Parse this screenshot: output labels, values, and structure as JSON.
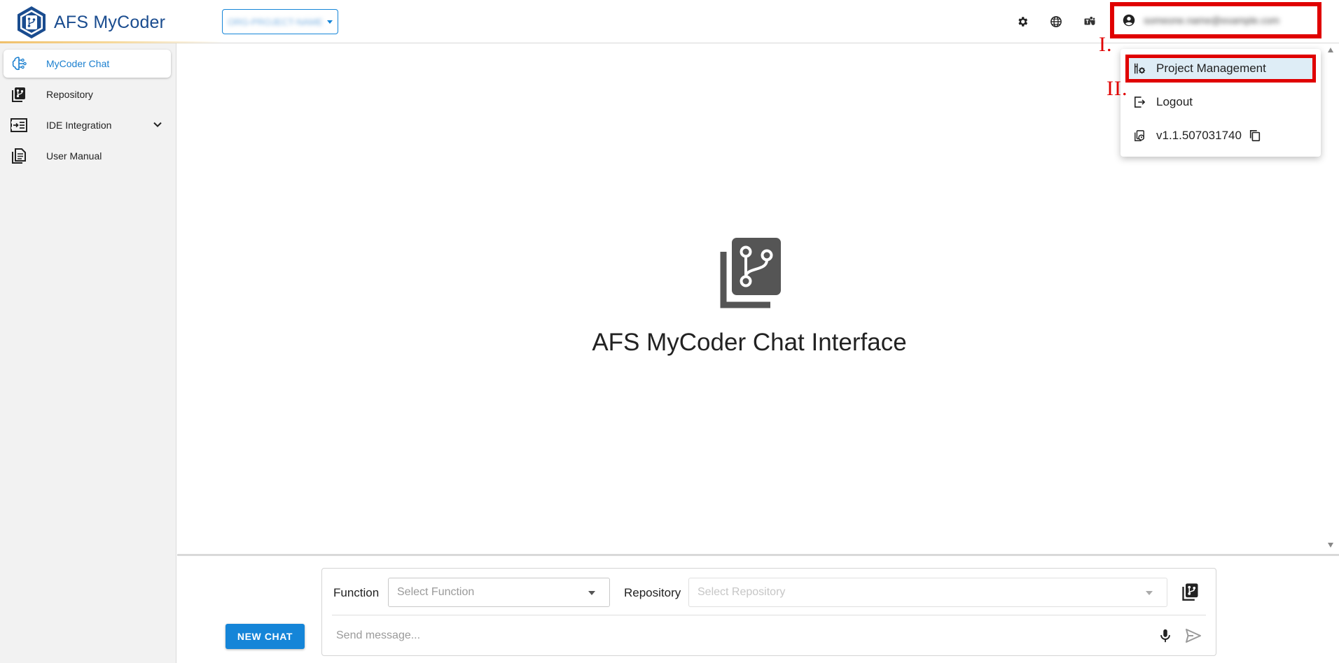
{
  "app": {
    "name": "AFS MyCoder",
    "project_selector": "ORG-PROJECT-NAME",
    "user_email": "someone.name@example.com"
  },
  "header": {
    "icons": [
      "settings-icon",
      "language-globe-icon",
      "teams-icon",
      "account-circle-icon"
    ]
  },
  "sidebar": {
    "items": [
      {
        "label": "MyCoder Chat",
        "icon": "brain-circuit-icon",
        "active": true
      },
      {
        "label": "Repository",
        "icon": "repository-icon"
      },
      {
        "label": "IDE Integration",
        "icon": "ide-integration-icon",
        "expandable": true
      },
      {
        "label": "User Manual",
        "icon": "document-icon"
      }
    ]
  },
  "main": {
    "title": "AFS MyCoder Chat Interface",
    "hero_icon": "repository-icon"
  },
  "chat": {
    "new_chat_label": "NEW CHAT",
    "function_label": "Function",
    "function_placeholder": "Select Function",
    "repository_label": "Repository",
    "repository_placeholder": "Select Repository",
    "message_placeholder": "Send message..."
  },
  "user_menu": {
    "items": [
      {
        "label": "Project Management",
        "icon": "project-tools-icon",
        "highlighted": true
      },
      {
        "label": "Logout",
        "icon": "logout-icon"
      },
      {
        "label": "v1.1.507031740",
        "icon": "version-icon"
      }
    ]
  },
  "annotations": {
    "step1": "I.",
    "step2": "II."
  },
  "colors": {
    "brand_blue": "#1585d8",
    "logo_navy": "#1a4c8f",
    "annotation_red": "#e00000",
    "menu_highlight": "#deedf6"
  }
}
